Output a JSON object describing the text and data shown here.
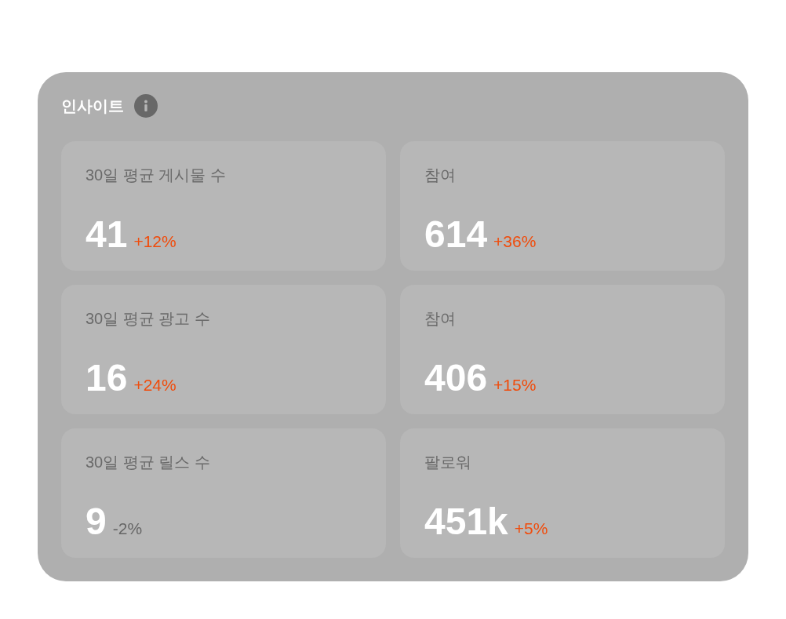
{
  "panel": {
    "title": "인사이트"
  },
  "cards": [
    {
      "label": "30일 평균 게시물 수",
      "value": "41",
      "change": "+12%",
      "positive": true
    },
    {
      "label": "참여",
      "value": "614",
      "change": "+36%",
      "positive": true
    },
    {
      "label": "30일 평균 광고 수",
      "value": "16",
      "change": "+24%",
      "positive": true
    },
    {
      "label": "참여",
      "value": "406",
      "change": "+15%",
      "positive": true
    },
    {
      "label": "30일 평균 릴스 수",
      "value": "9",
      "change": "-2%",
      "positive": false
    },
    {
      "label": "팔로워",
      "value": "451k",
      "change": "+5%",
      "positive": true
    }
  ]
}
